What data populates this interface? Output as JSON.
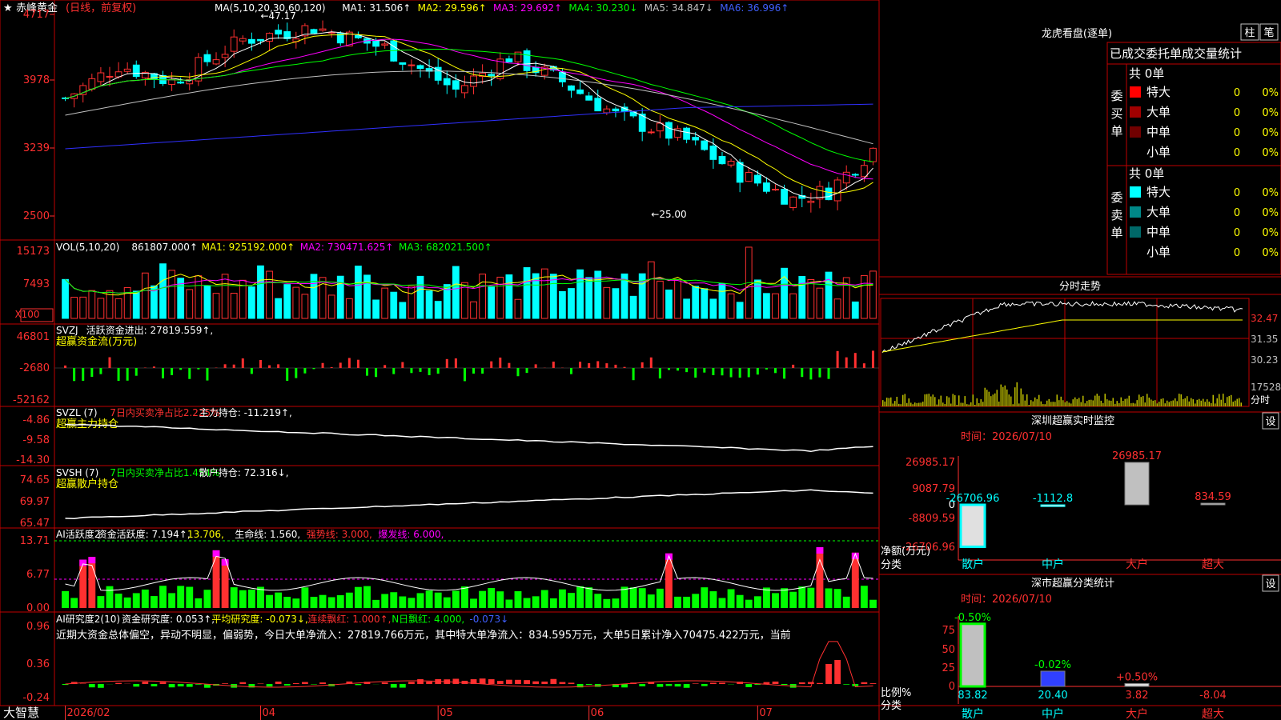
{
  "app": {
    "star_icon": "★",
    "stock_name": "赤峰黄金",
    "period_label": "(日线，前复权)",
    "bottom_label": "大智慧"
  },
  "colors": {
    "up": "#ff3030",
    "down": "#00ffff",
    "ma1": "#ffffff",
    "ma2": "#ffff00",
    "ma3": "#ff00ff",
    "ma4": "#00ff00",
    "ma5": "#c0c0c0",
    "ma6": "#3030ff",
    "panel_border": "#c00000"
  },
  "price_panel": {
    "indicator_line": [
      {
        "text": "MA(5,10,20,30,60,120)",
        "color": "#ffffff"
      },
      {
        "text": "MA1: 31.506↑",
        "color": "#ffffff"
      },
      {
        "text": "MA2: 29.596↑",
        "color": "#ffff00"
      },
      {
        "text": "MA3: 29.692↑",
        "color": "#ff00ff"
      },
      {
        "text": "MA4: 30.230↓",
        "color": "#00ff00"
      },
      {
        "text": "MA5: 34.847↓",
        "color": "#c0c0c0"
      },
      {
        "text": "MA6: 36.996↑",
        "color": "#4060ff"
      }
    ],
    "y_ticks": [
      "4717",
      "3978",
      "3239",
      "2500"
    ],
    "high_label": "←47.17",
    "low_label": "←25.00"
  },
  "vol_panel": {
    "indicator_line": [
      {
        "text": "VOL(5,10,20)",
        "color": "#ffffff"
      },
      {
        "text": "861807.000↑",
        "color": "#ffffff"
      },
      {
        "text": "MA1: 925192.000↑",
        "color": "#ffff00"
      },
      {
        "text": "MA2: 730471.625↑",
        "color": "#ff00ff"
      },
      {
        "text": "MA3: 682021.500↑",
        "color": "#00ff00"
      }
    ],
    "y_ticks": [
      "15173",
      "7493"
    ],
    "unit": "X100"
  },
  "svzj_panel": {
    "indicator_line": [
      {
        "text": "SVZJ",
        "color": "#ffffff"
      },
      {
        "text": "活跃资金进出: 27819.559↑,",
        "color": "#ffffff"
      }
    ],
    "subtitle": "超赢资金流(万元)",
    "y_ticks": [
      "46801",
      "-2680",
      "-52162"
    ]
  },
  "svzl_panel": {
    "indicator_line": [
      {
        "text": "SVZL (7)",
        "color": "#ffffff"
      },
      {
        "text": "7日内买卖净占比2.225%",
        "color": "#ff3030"
      },
      {
        "text": "主力持仓: -11.219↑,",
        "color": "#ffffff"
      }
    ],
    "subtitle": "超赢主力持仓",
    "y_ticks": [
      "-4.86",
      "-9.58",
      "-14.30"
    ]
  },
  "svsh_panel": {
    "indicator_line": [
      {
        "text": "SVSH (7)",
        "color": "#ffffff"
      },
      {
        "text": "7日内买卖净占比1.454%",
        "color": "#00ff00"
      },
      {
        "text": "散户持仓: 72.316↓,",
        "color": "#ffffff"
      }
    ],
    "subtitle": "超赢散户持仓",
    "y_ticks": [
      "74.65",
      "69.97",
      "65.47"
    ]
  },
  "ai_active_panel": {
    "indicator_line": [
      {
        "text": "AI活跃度2",
        "color": "#ffffff"
      },
      {
        "text": "资金活跃度: 7.194↑,",
        "color": "#ffffff"
      },
      {
        "text": "13.706,",
        "color": "#ffff00"
      },
      {
        "text": "生命线: 1.560,",
        "color": "#ffffff"
      },
      {
        "text": "强势线: 3.000,",
        "color": "#ff3030"
      },
      {
        "text": "爆发线: 6.000,",
        "color": "#ff00ff"
      }
    ],
    "y_ticks": [
      "13.71",
      "6.77",
      "0.00"
    ]
  },
  "ai_research_panel": {
    "indicator_line": [
      {
        "text": "AI研究度2(10)",
        "color": "#ffffff"
      },
      {
        "text": "资金研究度: 0.053↑,",
        "color": "#ffffff"
      },
      {
        "text": "平均研究度: -0.073↓,",
        "color": "#ffff00"
      },
      {
        "text": "连续飘红: 1.000↑,",
        "color": "#ff3030"
      },
      {
        "text": "N日飘红: 4.000,",
        "color": "#00ff00"
      },
      {
        "text": "-0.073↓",
        "color": "#4060ff"
      }
    ],
    "comment": "近期大资金总体偏空，异动不明显，偏弱势，今日大单净流入：27819.766万元，其中特大单净流入：834.595万元，大单5日累计净入70475.422万元，当前",
    "y_ticks": [
      "0.96",
      "0.36",
      "-0.24"
    ]
  },
  "x_axis": {
    "labels": [
      "2026/02",
      "04",
      "05",
      "06",
      "07"
    ]
  },
  "dragon_tiger": {
    "title": "龙虎看盘(逐单)",
    "btn_bar": "柱",
    "btn_pen": "笔",
    "stats_title": "已成交委托单成交量统计",
    "buy_label": "委买单",
    "sell_label": "委卖单",
    "buy_total": "共 0单",
    "sell_total": "共 0单",
    "buy_rows": [
      {
        "name": "特大",
        "count": "0",
        "pct": "0%",
        "swatch": "#ff0000"
      },
      {
        "name": "大单",
        "count": "0",
        "pct": "0%",
        "swatch": "#a00000"
      },
      {
        "name": "中单",
        "count": "0",
        "pct": "0%",
        "swatch": "#700000"
      },
      {
        "name": "小单",
        "count": "0",
        "pct": "0%",
        "swatch": "#000000"
      }
    ],
    "sell_rows": [
      {
        "name": "特大",
        "count": "0",
        "pct": "0%",
        "swatch": "#00ffff"
      },
      {
        "name": "大单",
        "count": "0",
        "pct": "0%",
        "swatch": "#008888"
      },
      {
        "name": "中单",
        "count": "0",
        "pct": "0%",
        "swatch": "#006868"
      },
      {
        "name": "小单",
        "count": "0",
        "pct": "0%",
        "swatch": "#000000"
      }
    ]
  },
  "intraday": {
    "title": "分时走势",
    "y_ticks": [
      "32.47",
      "31.35",
      "30.23"
    ],
    "vol_tick": "17528",
    "vol_label": "分时"
  },
  "sz_monitor": {
    "title": "深圳超赢实时监控",
    "btn": "设",
    "time_label": "时间：2026/07/10",
    "y_ticks": [
      "26985.17",
      "9087.79",
      "0",
      "-8809.59",
      "-26706.96"
    ],
    "unit_label": "净额(万元)",
    "cat_label": "分类",
    "categories": [
      "散户",
      "中户",
      "大户",
      "超大"
    ],
    "values": [
      -26706.96,
      -1112.8,
      26985.17,
      834.59
    ],
    "value_labels": [
      "-26706.96",
      "-1112.8",
      "26985.17",
      "834.59"
    ]
  },
  "sz_class": {
    "title": "深市超赢分类统计",
    "btn": "设",
    "time_label": "时间：2026/07/10",
    "y_ticks": [
      "75",
      "50",
      "25",
      "0"
    ],
    "unit_label": "比例%",
    "cat_label": "分类",
    "categories": [
      "散户",
      "中户",
      "大户",
      "超大"
    ],
    "values": [
      83.82,
      20.4,
      3.82,
      -8.04
    ],
    "value_labels": [
      "83.82",
      "20.40",
      "3.82",
      "-8.04"
    ],
    "change_labels": [
      "-0.50%",
      "-0.02%",
      "+0.50%",
      ""
    ]
  },
  "chart_data": [
    {
      "type": "candlestick",
      "title": "赤峰黄金(日线，前复权)",
      "ylim": [
        25.0,
        47.17
      ],
      "x_labels": [
        "2026/02",
        "04",
        "05",
        "06",
        "07"
      ],
      "high": 47.17,
      "low": 25.0,
      "series": [
        {
          "name": "MA1",
          "last": 31.506
        },
        {
          "name": "MA2",
          "last": 29.596
        },
        {
          "name": "MA3",
          "last": 29.692
        },
        {
          "name": "MA4",
          "last": 30.23
        },
        {
          "name": "MA5",
          "last": 34.847
        },
        {
          "name": "MA6",
          "last": 36.996
        }
      ]
    },
    {
      "type": "bar",
      "title": "VOL(5,10,20)",
      "last": 861807.0,
      "series": [
        {
          "name": "MA1",
          "last": 925192.0
        },
        {
          "name": "MA2",
          "last": 730471.625
        },
        {
          "name": "MA3",
          "last": 682021.5
        }
      ]
    },
    {
      "type": "bar",
      "title": "超赢资金流(万元)",
      "last": 27819.559,
      "ylim": [
        -52162,
        46801
      ]
    },
    {
      "type": "bar",
      "title": "深圳超赢实时监控",
      "categories": [
        "散户",
        "中户",
        "大户",
        "超大"
      ],
      "values": [
        -26706.96,
        -1112.8,
        26985.17,
        834.59
      ]
    },
    {
      "type": "bar",
      "title": "深市超赢分类统计",
      "categories": [
        "散户",
        "中户",
        "大户",
        "超大"
      ],
      "values": [
        83.82,
        20.4,
        3.82,
        -8.04
      ]
    }
  ]
}
